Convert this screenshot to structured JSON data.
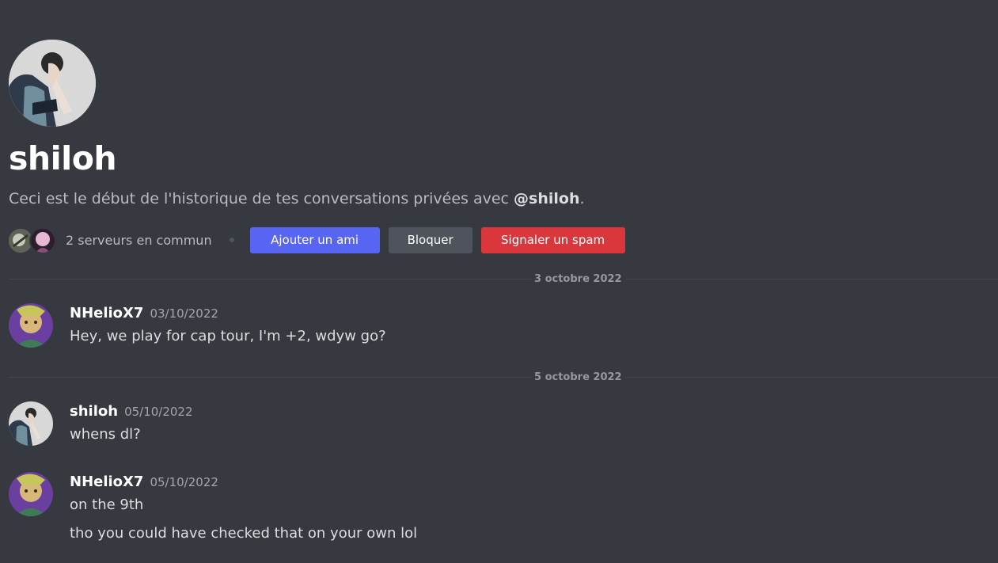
{
  "profile": {
    "name": "shiloh",
    "intro_prefix": "Ceci est le début de l'historique de tes conversations privées avec ",
    "intro_mention": "@shiloh",
    "intro_suffix": "."
  },
  "mutual": {
    "label": "2 serveurs en commun"
  },
  "actions": {
    "add_friend": "Ajouter un ami",
    "block": "Bloquer",
    "report_spam": "Signaler un spam"
  },
  "dividers": [
    {
      "label": "3 octobre 2022"
    },
    {
      "label": "5 octobre 2022"
    }
  ],
  "messages": [
    {
      "author": "NHelioX7",
      "time": "03/10/2022",
      "lines": [
        "Hey, we play for cap tour, I'm +2, wdyw go?"
      ]
    },
    {
      "author": "shiloh",
      "time": "05/10/2022",
      "lines": [
        "whens dl?"
      ]
    },
    {
      "author": "NHelioX7",
      "time": "05/10/2022",
      "lines": [
        "on the 9th",
        "tho you could have checked that on your own lol"
      ]
    }
  ],
  "colors": {
    "background": "#36393f",
    "blurple": "#5865f2",
    "secondary": "#4f545c",
    "danger": "#da373c"
  }
}
